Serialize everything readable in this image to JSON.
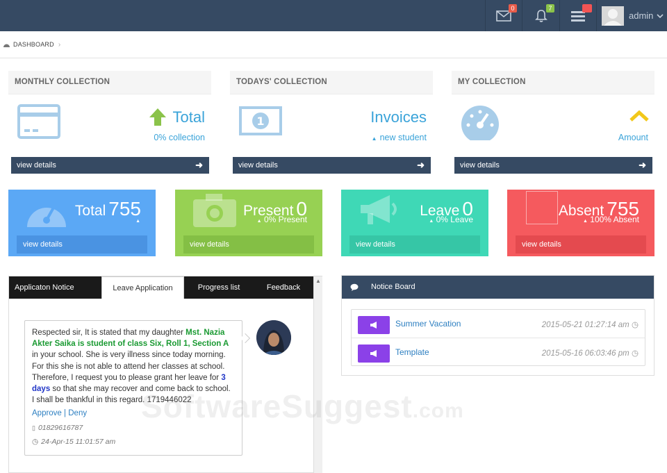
{
  "topbar": {
    "mail_badge": "0",
    "bell_badge": "7",
    "tasks_badge": "",
    "username": "admin",
    "colors": {
      "bar": "#364a63",
      "mail_badge": "#e85c4a",
      "bell_badge": "#8bc34a",
      "tasks_badge": "#f25454"
    }
  },
  "breadcrumb": {
    "label": "DASHBOARD"
  },
  "collections": [
    {
      "header": "MONTHLY COLLECTION",
      "title": "Total",
      "subtitle": "0% collection",
      "footer": "view details",
      "icon": "credit-card-icon"
    },
    {
      "header": "TODAYS' COLLECTION",
      "title": "Invoices",
      "subtitle": "new student",
      "footer": "view details",
      "icon": "money-bill-icon"
    },
    {
      "header": "MY COLLECTION",
      "title": "",
      "subtitle": "Amount",
      "footer": "view details",
      "icon": "dashboard-gauge-icon"
    }
  ],
  "tiles": [
    {
      "label": "Total",
      "value": "755",
      "sub": "",
      "footer": "view details",
      "icon": "gauge-icon",
      "color": "#5ba8f5"
    },
    {
      "label": "Present",
      "value": "0",
      "sub": "0% Present",
      "footer": "view details",
      "icon": "camera-icon",
      "color": "#97d153"
    },
    {
      "label": "Leave",
      "value": "0",
      "sub": "0% Leave",
      "footer": "view details",
      "icon": "megaphone-icon",
      "color": "#3fd8b6"
    },
    {
      "label": "Absent",
      "value": "755",
      "sub": "100% Absent",
      "footer": "view details",
      "icon": "image-icon",
      "color": "#f55a5e"
    }
  ],
  "application": {
    "tabs": [
      "Applicaton Notice",
      "Leave Application",
      "Progress list",
      "Feedback"
    ],
    "active_tab": 1,
    "text_1": "Respected sir, It is stated that my daughter ",
    "text_highlight_1": "Mst. Nazia Akter Saika is student of class Six, Roll 1, Section A",
    "text_2": " in your school. She is very illness since today morning. For this she is not able to attend her classes at school. Therefore, I request you to please grant her leave for ",
    "text_highlight_2": "3 days",
    "text_3": " so that she may recover and come back to school. I shall be thankful in this regard. 1719446022",
    "approve": "Approve",
    "separator": "|",
    "deny": "Deny",
    "phone": "01829616787",
    "datetime": "24-Apr-15 11:01:57 am"
  },
  "notice_board": {
    "title": "Notice Board",
    "items": [
      {
        "title": "Summer Vacation",
        "time": "2015-05-21 01:27:14 am"
      },
      {
        "title": "Template",
        "time": "2015-05-16 06:03:46 pm"
      }
    ]
  },
  "watermark": {
    "main": "SoftwareSuggest",
    "suffix": ".com"
  }
}
